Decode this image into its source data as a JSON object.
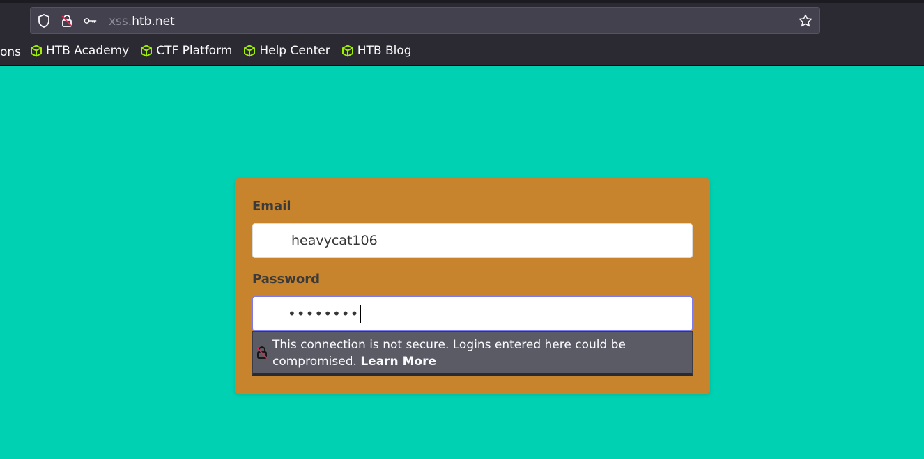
{
  "browser": {
    "url_subdomain": "xss.",
    "url_domain": "htb.net",
    "bookmarks_partial": "ons",
    "bookmarks": [
      {
        "label": "HTB Academy"
      },
      {
        "label": "CTF Platform"
      },
      {
        "label": "Help Center"
      },
      {
        "label": "HTB Blog"
      }
    ]
  },
  "login": {
    "email_label": "Email",
    "email_value": "heavycat106",
    "password_label": "Password",
    "password_value": "••••••••"
  },
  "insecure_popup": {
    "message": "This connection is not secure. Logins entered here could be compromised.",
    "link": "Learn More"
  },
  "colors": {
    "page_bg": "#00d1b2",
    "card_bg": "#c8842d",
    "bookmark_icon": "#9fef00",
    "popup_bg": "#5b5b66"
  }
}
